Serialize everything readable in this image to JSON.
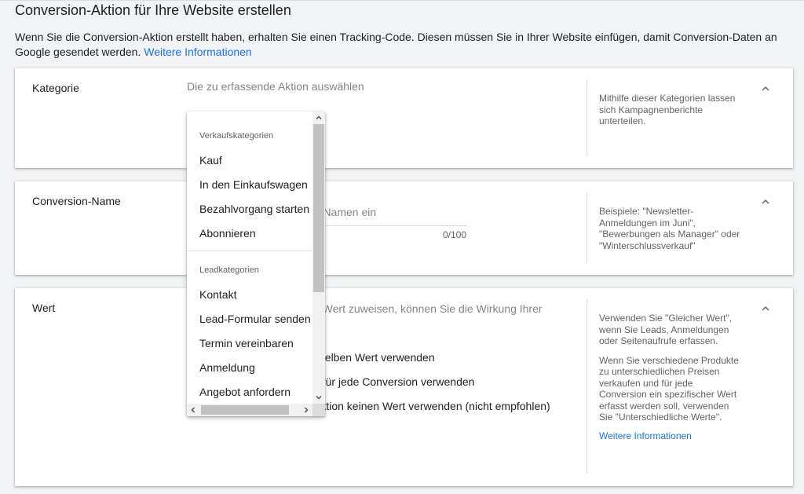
{
  "page": {
    "title": "Conversion-Aktion für Ihre Website erstellen",
    "intro_text": "Wenn Sie die Conversion-Aktion erstellt haben, erhalten Sie einen Tracking-Code. Diesen müssen Sie in Ihrer Website einfügen, damit Conversion-Daten an Google gesendet werden. ",
    "intro_link": "Weitere Informationen"
  },
  "kategorie": {
    "label": "Kategorie",
    "placeholder": "Die zu erfassende Aktion auswählen",
    "help": "Mithilfe dieser Kategorien lassen sich Kampagnenberichte unterteilen."
  },
  "conversion_name": {
    "label": "Conversion-Name",
    "placeholder_visible": "n-Namen ein",
    "counter": "0/100",
    "help": "Beispiele: \"Newsletter-Anmeldungen im Juni\", \"Bewerbungen als Manager\" oder \"Winterschlussverkauf\""
  },
  "wert": {
    "label": "Wert",
    "description_visible": "n Wert zuweisen, können Sie die Wirkung Ihrer",
    "options_visible": [
      "nselben Wert verwenden",
      "e für jede Conversion verwenden",
      "Aktion keinen Wert verwenden (nicht empfohlen)"
    ],
    "help_1": "Verwenden Sie \"Gleicher Wert\", wenn Sie Leads, Anmeldungen oder Seitenaufrufe erfassen.",
    "help_2": "Wenn Sie verschiedene Produkte zu unterschiedlichen Preisen verkaufen und für jede Conversion ein spezifischer Wert erfasst werden soll, verwenden Sie \"Unterschiedliche Werte\".",
    "help_link": "Weitere Informationen"
  },
  "dropdown": {
    "section_sales": "Verkaufskategorien",
    "sales_items": [
      "Kauf",
      "In den Einkaufswagen",
      "Bezahlvorgang starten",
      "Abonnieren"
    ],
    "section_leads": "Leadkategorien",
    "lead_items": [
      "Kontakt",
      "Lead-Formular senden",
      "Termin vereinbaren",
      "Anmeldung",
      "Angebot anfordern"
    ]
  },
  "colors": {
    "link": "#1a73e8",
    "background": "#f1f3f4",
    "card": "#ffffff",
    "muted_text": "#5f6368"
  },
  "icons": {
    "collapse": "chevron-up-icon",
    "scroll_up": "scroll-up-arrow-icon",
    "scroll_down": "scroll-down-arrow-icon",
    "scroll_left": "scroll-left-arrow-icon",
    "scroll_right": "scroll-right-arrow-icon"
  }
}
